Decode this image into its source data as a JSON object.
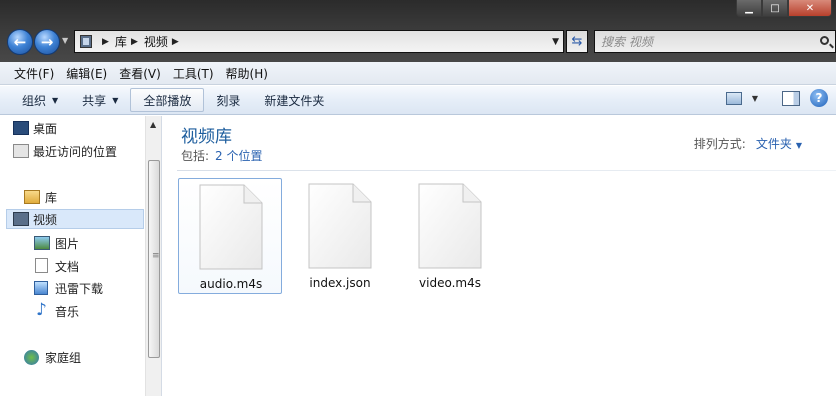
{
  "window": {
    "addressbar": {
      "crumbs": [
        "库",
        "视频"
      ]
    },
    "search": {
      "placeholder": "搜索 视频"
    }
  },
  "menubar": {
    "items": [
      "文件(F)",
      "编辑(E)",
      "查看(V)",
      "工具(T)",
      "帮助(H)"
    ]
  },
  "toolbar": {
    "organize": "组织",
    "share": "共享",
    "play_all": "全部播放",
    "burn": "刻录",
    "new_folder": "新建文件夹"
  },
  "navpane": {
    "favorites": [
      {
        "label": "桌面",
        "icon": "desktop-icon"
      },
      {
        "label": "最近访问的位置",
        "icon": "recent-places-icon"
      }
    ],
    "library_header": {
      "label": "库",
      "icon": "library-icon"
    },
    "libraries": [
      {
        "label": "视频",
        "icon": "video-library-icon",
        "selected": true
      },
      {
        "label": "图片",
        "icon": "pictures-icon"
      },
      {
        "label": "文档",
        "icon": "documents-icon"
      },
      {
        "label": "迅雷下载",
        "icon": "download-library-icon"
      },
      {
        "label": "音乐",
        "icon": "music-icon"
      }
    ],
    "homegroup": {
      "label": "家庭组",
      "icon": "homegroup-icon"
    }
  },
  "content": {
    "title": "视频库",
    "subtitle_prefix": "包括:",
    "subtitle_count": "2 个位置",
    "arrange_label": "排列方式:",
    "arrange_value": "文件夹",
    "files": [
      {
        "name": "audio.m4s",
        "selected": true
      },
      {
        "name": "index.json",
        "selected": false
      },
      {
        "name": "video.m4s",
        "selected": false
      }
    ]
  },
  "colors": {
    "title_blue": "#1e5e9e",
    "link_blue": "#2a62b0",
    "selection": "#d9e8fa"
  }
}
